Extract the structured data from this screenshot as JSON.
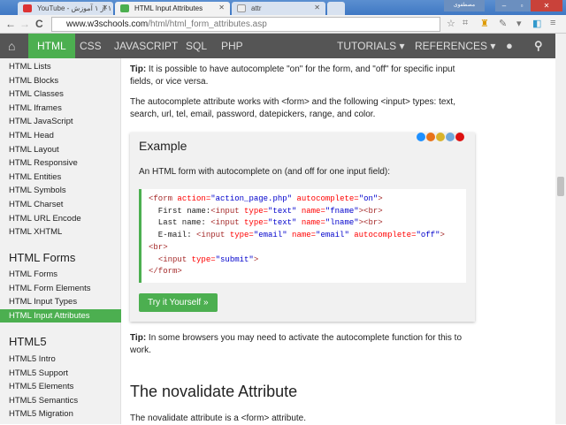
{
  "browser": {
    "tabs": [
      {
        "label": "YouTube - ١ از ١ آموزش",
        "fav": "#d33"
      },
      {
        "label": "HTML Input Attributes",
        "fav": "#4caf50",
        "active": true
      },
      {
        "label": "attr",
        "fav": "#ccc"
      }
    ],
    "user_label": "مصطفوی",
    "url_host": "www.w3schools.com",
    "url_path": "/html/html_form_attributes.asp"
  },
  "topnav": {
    "home_icon": "home-icon",
    "items": [
      "HTML",
      "CSS",
      "JAVASCRIPT",
      "SQL",
      "PHP"
    ],
    "tutorials": "TUTORIALS ▾",
    "references": "REFERENCES ▾",
    "globe_icon": "globe-icon",
    "search_icon": "search-icon"
  },
  "sidebar": {
    "items1": [
      "HTML Lists",
      "HTML Blocks",
      "HTML Classes",
      "HTML Iframes",
      "HTML JavaScript",
      "HTML Head",
      "HTML Layout",
      "HTML Responsive",
      "HTML Entities",
      "HTML Symbols",
      "HTML Charset",
      "HTML URL Encode",
      "HTML XHTML"
    ],
    "heading2": "HTML Forms",
    "items2": [
      "HTML Forms",
      "HTML Form Elements",
      "HTML Input Types",
      "HTML Input Attributes"
    ],
    "heading3": "HTML5",
    "items3": [
      "HTML5 Intro",
      "HTML5 Support",
      "HTML5 Elements",
      "HTML5 Semantics",
      "HTML5 Migration"
    ]
  },
  "main": {
    "tip1_label": "Tip:",
    "tip1": " It is possible to have autocomplete \"on\" for the form, and \"off\" for specific input fields, or vice versa.",
    "para1": "The autocomplete attribute works with <form> and the following <input> types: text, search, url, tel, email, password, datepickers, range, and color.",
    "example_title": "Example",
    "example_desc": "An HTML form with autocomplete on (and off for one input field):",
    "code": [
      [
        [
          "tg",
          "<form"
        ],
        [
          "at",
          " action="
        ],
        [
          "v",
          "\"action_page.php\""
        ],
        [
          "at",
          " autocomplete="
        ],
        [
          "v",
          "\"on\""
        ],
        [
          "tg",
          ">"
        ]
      ],
      [
        [
          "t",
          "  First name:"
        ],
        [
          "tg",
          "<input"
        ],
        [
          "at",
          " type="
        ],
        [
          "v",
          "\"text\""
        ],
        [
          "at",
          " name="
        ],
        [
          "v",
          "\"fname\""
        ],
        [
          "tg",
          "><br>"
        ]
      ],
      [
        [
          "t",
          "  Last name: "
        ],
        [
          "tg",
          "<input"
        ],
        [
          "at",
          " type="
        ],
        [
          "v",
          "\"text\""
        ],
        [
          "at",
          " name="
        ],
        [
          "v",
          "\"lname\""
        ],
        [
          "tg",
          "><br>"
        ]
      ],
      [
        [
          "t",
          "  E-mail: "
        ],
        [
          "tg",
          "<input"
        ],
        [
          "at",
          " type="
        ],
        [
          "v",
          "\"email\""
        ],
        [
          "at",
          " name="
        ],
        [
          "v",
          "\"email\""
        ],
        [
          "at",
          " autocomplete="
        ],
        [
          "v",
          "\"off\""
        ],
        [
          "tg",
          ">"
        ]
      ],
      [
        [
          "tg",
          "<br>"
        ]
      ],
      [
        [
          "t",
          "  "
        ],
        [
          "tg",
          "<input"
        ],
        [
          "at",
          " type="
        ],
        [
          "v",
          "\"submit\""
        ],
        [
          "tg",
          ">"
        ]
      ],
      [
        [
          "tg",
          "</form>"
        ]
      ]
    ],
    "try_button": "Try it Yourself »",
    "tip2_label": "Tip:",
    "tip2": " In some browsers you may need to activate the autocomplete function for this to work.",
    "section_title": "The novalidate Attribute",
    "para2": "The novalidate attribute is a <form> attribute."
  }
}
